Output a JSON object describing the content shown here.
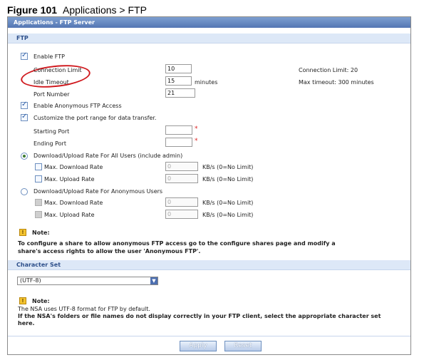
{
  "figure": {
    "number": "Figure 101",
    "title": "Applications > FTP"
  },
  "panel": {
    "title": "Applications - FTP Server"
  },
  "ftp": {
    "section": "FTP",
    "enable_ftp": "Enable FTP",
    "connection_limit_label": "Connection Limit",
    "connection_limit_value": "10",
    "connection_limit_hint": "Connection Limit: 20",
    "idle_timeout_label": "Idle Timeout",
    "idle_timeout_value": "15",
    "idle_timeout_unit": "minutes",
    "idle_timeout_hint": "Max timeout: 300 minutes",
    "port_number_label": "Port Number",
    "port_number_value": "21",
    "enable_anonymous": "Enable Anonymous FTP Access",
    "customize_port_range": "Customize the port range for data transfer.",
    "starting_port_label": "Starting Port",
    "ending_port_label": "Ending Port",
    "required_mark": "*",
    "rate_all_users": "Download/Upload Rate For All Users (include admin)",
    "rate_anonymous": "Download/Upload Rate For Anonymous Users",
    "max_download_rate": "Max. Download Rate",
    "max_upload_rate": "Max. Upload Rate",
    "rate_value": "0",
    "rate_unit": "KB/s (0=No Limit)"
  },
  "note1": {
    "label": "Note:",
    "line1": "To configure a share to allow anonymous FTP access go to the configure shares page and modify a",
    "line2": "share's access rights to allow the user 'Anonymous FTP'."
  },
  "charset": {
    "section": "Character Set",
    "selected": "(UTF-8)"
  },
  "note2": {
    "label": "Note:",
    "line1": "The NSA uses UTF-8 format for FTP by default.",
    "line2": "If the NSA's folders or file names do not display correctly in your FTP client, select the appropriate character set",
    "line3": "here."
  },
  "buttons": {
    "apply": "Apply",
    "reset": "Reset"
  },
  "colors": {
    "accent": "#5476b3",
    "annotation": "#d0191e"
  }
}
